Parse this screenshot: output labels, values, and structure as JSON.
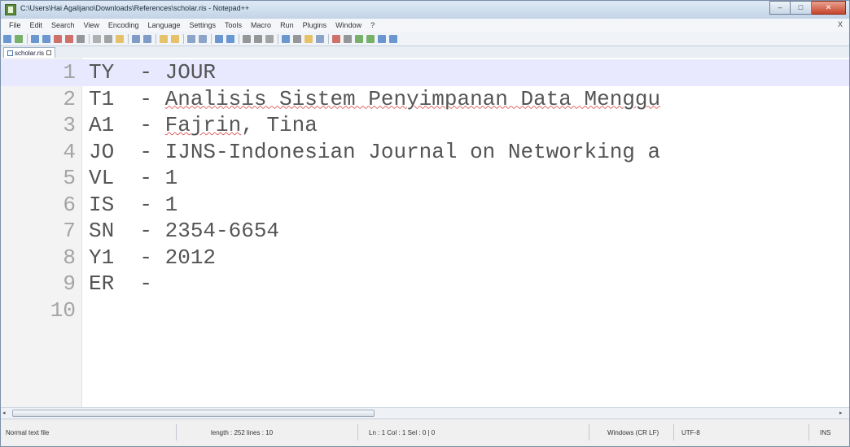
{
  "window": {
    "title": "C:\\Users\\Hai Agalijano\\Downloads\\References\\scholar.ris - Notepad++"
  },
  "window_buttons": {
    "minimize": "–",
    "maximize": "□",
    "close": "✕"
  },
  "menu": {
    "items": [
      "File",
      "Edit",
      "Search",
      "View",
      "Encoding",
      "Language",
      "Settings",
      "Tools",
      "Macro",
      "Run",
      "Plugins",
      "Window",
      "?"
    ],
    "close_label": "X"
  },
  "toolbar": {
    "icons": [
      "new-file-icon",
      "open-file-icon",
      "save-icon",
      "save-all-icon",
      "close-icon",
      "close-all-icon",
      "print-icon",
      "cut-icon",
      "copy-icon",
      "paste-icon",
      "undo-icon",
      "redo-icon",
      "find-icon",
      "replace-icon",
      "zoom-in-icon",
      "zoom-out-icon",
      "sync-v-icon",
      "sync-h-icon",
      "wrap-icon",
      "all-chars-icon",
      "indent-guide-icon",
      "doc-map-icon",
      "function-list-icon",
      "folder-workspace-icon",
      "monitor-icon",
      "record-macro-icon",
      "stop-macro-icon",
      "play-macro-icon",
      "run-macro-icon",
      "save-macro-icon",
      "spell-check-icon"
    ],
    "colors": {
      "accent": "#3f78c4",
      "green": "#4f9a3a",
      "red": "#c4443c",
      "yellow": "#e2b23a"
    }
  },
  "tab": {
    "label": "scholar.ris"
  },
  "editor": {
    "current_line": 1,
    "lines": [
      {
        "num": "1",
        "text": "TY  - JOUR"
      },
      {
        "num": "2",
        "tag": "T1  - ",
        "spell": "Analisis Sistem Penyimpanan Data Menggu"
      },
      {
        "num": "3",
        "tag": "A1  - ",
        "spell": "Fajrin",
        "rest": ", Tina"
      },
      {
        "num": "4",
        "text": "JO  - IJNS-Indonesian Journal on Networking a"
      },
      {
        "num": "5",
        "text": "VL  - 1"
      },
      {
        "num": "6",
        "text": "IS  - 1"
      },
      {
        "num": "7",
        "text": "SN  - 2354-6654"
      },
      {
        "num": "8",
        "text": "Y1  - 2012"
      },
      {
        "num": "9",
        "text": "ER  -"
      },
      {
        "num": "10",
        "text": ""
      }
    ]
  },
  "statusbar": {
    "file_type": "Normal text file",
    "length": "length : 252    lines : 10",
    "position": "Ln : 1    Col : 1    Sel : 0 | 0",
    "eol": "Windows (CR LF)",
    "encoding": "UTF-8",
    "mode": "INS"
  }
}
